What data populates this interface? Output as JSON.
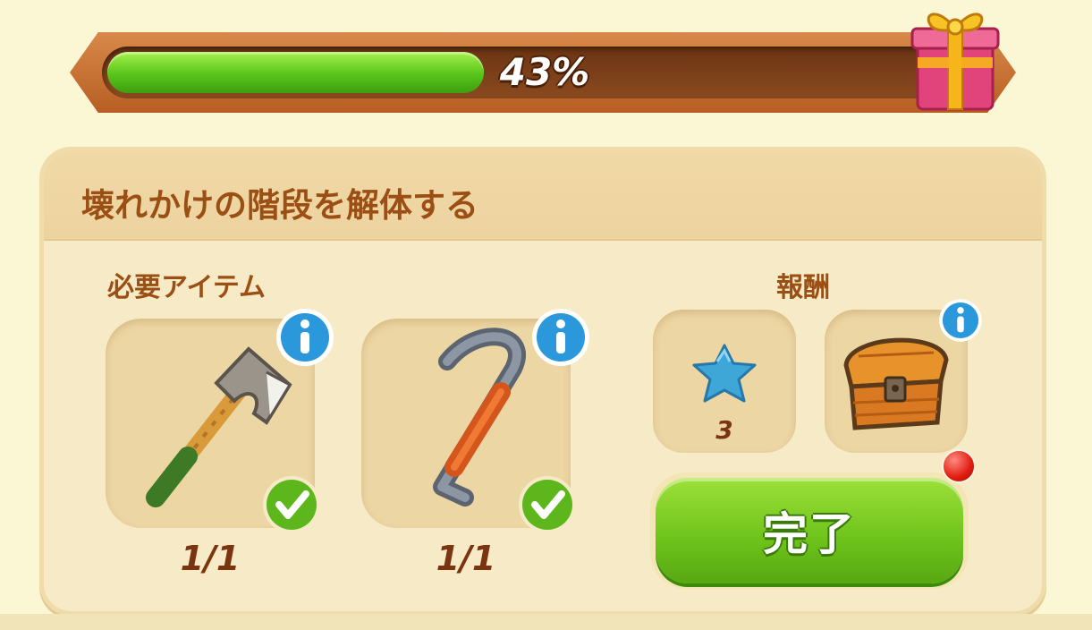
{
  "progress": {
    "percent": 43,
    "label": "43%"
  },
  "task": {
    "title": "壊れかけの階段を解体する"
  },
  "required": {
    "label": "必要アイテム",
    "items": [
      {
        "icon": "axe-icon",
        "count": "1/1"
      },
      {
        "icon": "crowbar-icon",
        "count": "1/1"
      }
    ]
  },
  "rewards": {
    "label": "報酬",
    "items": [
      {
        "icon": "blue-star-icon",
        "count": "3"
      },
      {
        "icon": "treasure-chest-icon"
      }
    ]
  },
  "complete_button": {
    "label": "完了"
  },
  "colors": {
    "background": "#fbf6d4",
    "title_brown": "#9b4f14",
    "progress_green": "#58c51a",
    "button_green": "#6cc21a"
  }
}
